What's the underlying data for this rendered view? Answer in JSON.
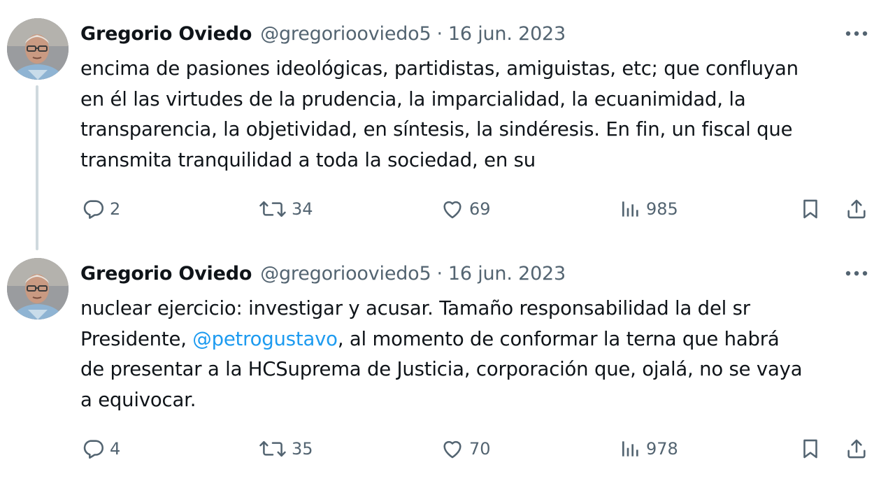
{
  "tweets": [
    {
      "author": {
        "name": "Gregorio Oviedo",
        "handle": "@gregoriooviedo5"
      },
      "separator": "·",
      "date": "16 jun. 2023",
      "lines": [
        "encima de pasiones ideológicas, partidistas, amiguistas, etc; que confluyan",
        "en él las virtudes de la prudencia, la imparcialidad, la ecuanimidad, la",
        "transparencia, la objetividad, en síntesis, la sindéresis. En fin, un fiscal que",
        "transmita tranquilidad a toda la sociedad, en su"
      ],
      "metrics": {
        "replies": "2",
        "retweets": "34",
        "likes": "69",
        "views": "985"
      }
    },
    {
      "author": {
        "name": "Gregorio Oviedo",
        "handle": "@gregoriooviedo5"
      },
      "separator": "·",
      "date": "16 jun. 2023",
      "lines": [
        "nuclear ejercicio: investigar y acusar. Tamaño responsabilidad la del sr",
        {
          "before": "Presidente, ",
          "mention": "@petrogustavo",
          "after": ", al momento de conformar la terna que habrá"
        },
        "de presentar a la HCSuprema de Justicia, corporación que, ojalá, no se vaya",
        "a equivocar."
      ],
      "metrics": {
        "replies": "4",
        "retweets": "35",
        "likes": "70",
        "views": "978"
      }
    }
  ],
  "icons": {
    "more": "more-icon",
    "reply": "reply-icon",
    "retweet": "retweet-icon",
    "like": "heart-icon",
    "views": "views-icon",
    "bookmark": "bookmark-icon",
    "share": "share-icon"
  },
  "colors": {
    "text": "#0f1419",
    "secondary": "#536471",
    "link": "#1d9bf0",
    "thread_line": "#cfd9de"
  }
}
